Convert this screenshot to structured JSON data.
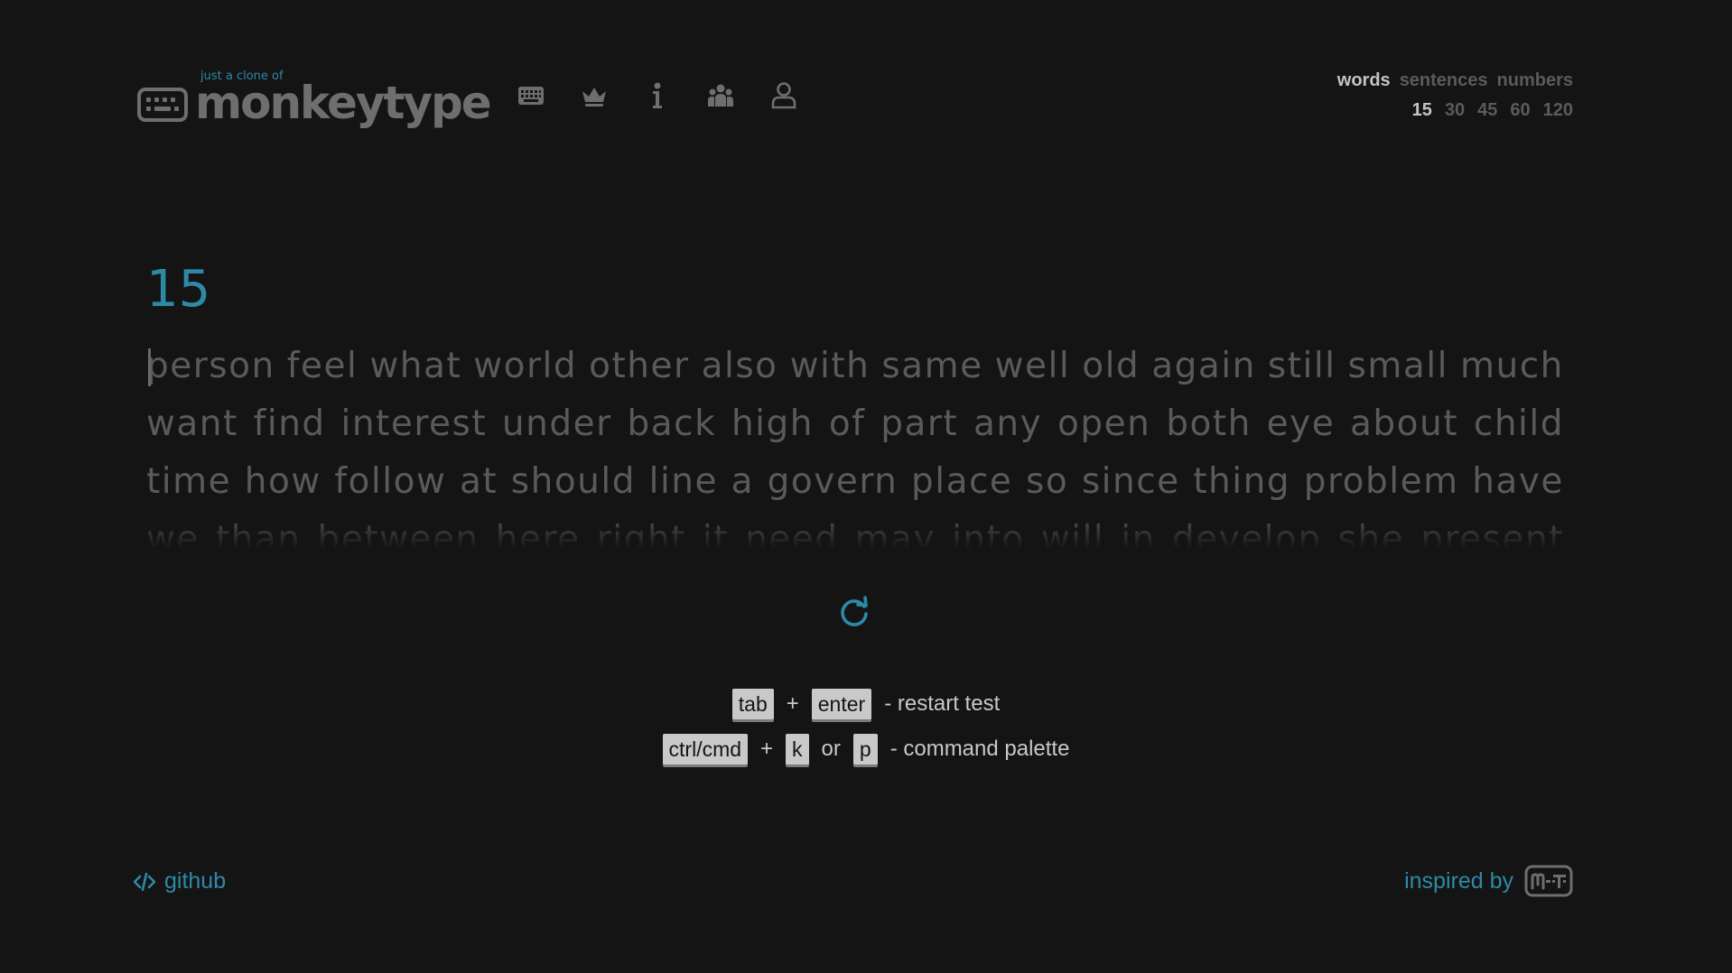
{
  "header": {
    "logo_subtitle": "just a clone of",
    "logo_title": "monkeytype",
    "nav": [
      {
        "name": "keyboard-icon"
      },
      {
        "name": "crown-icon"
      },
      {
        "name": "info-icon"
      },
      {
        "name": "users-icon"
      },
      {
        "name": "user-icon"
      }
    ]
  },
  "modes": {
    "types": [
      "words",
      "sentences",
      "numbers"
    ],
    "selected_type": "words",
    "counts": [
      "15",
      "30",
      "45",
      "60",
      "120"
    ],
    "selected_count": "15"
  },
  "test": {
    "counter": "15",
    "lines": [
      [
        "person",
        "feel",
        "what",
        "world",
        "other",
        "also",
        "with",
        "same",
        "well",
        "old",
        "again",
        "still",
        "small",
        "much"
      ],
      [
        "want",
        "find",
        "interest",
        "under",
        "back",
        "high",
        "of",
        "part",
        "any",
        "open",
        "both",
        "eye",
        "about",
        "child"
      ],
      [
        "time",
        "how",
        "follow",
        "at",
        "should",
        "line",
        "a",
        "govern",
        "place",
        "so",
        "since",
        "thing",
        "problem",
        "have"
      ],
      [
        "we",
        "than",
        "between",
        "here",
        "right",
        "it",
        "need",
        "may",
        "into",
        "will",
        "in",
        "develop",
        "she",
        "present"
      ]
    ]
  },
  "hints": {
    "row1": {
      "key1": "tab",
      "plus": "+",
      "key2": "enter",
      "text": "- restart test"
    },
    "row2": {
      "key1": "ctrl/cmd",
      "plus": "+",
      "key2": "k",
      "or": "or",
      "key3": "p",
      "text": "- command palette"
    }
  },
  "footer": {
    "github_label": "github",
    "inspired_label": "inspired by"
  },
  "colors": {
    "background": "#141414",
    "accent": "#2d8aa6",
    "text_main": "#c4c4c4",
    "text_dim": "#5a5a5a"
  }
}
